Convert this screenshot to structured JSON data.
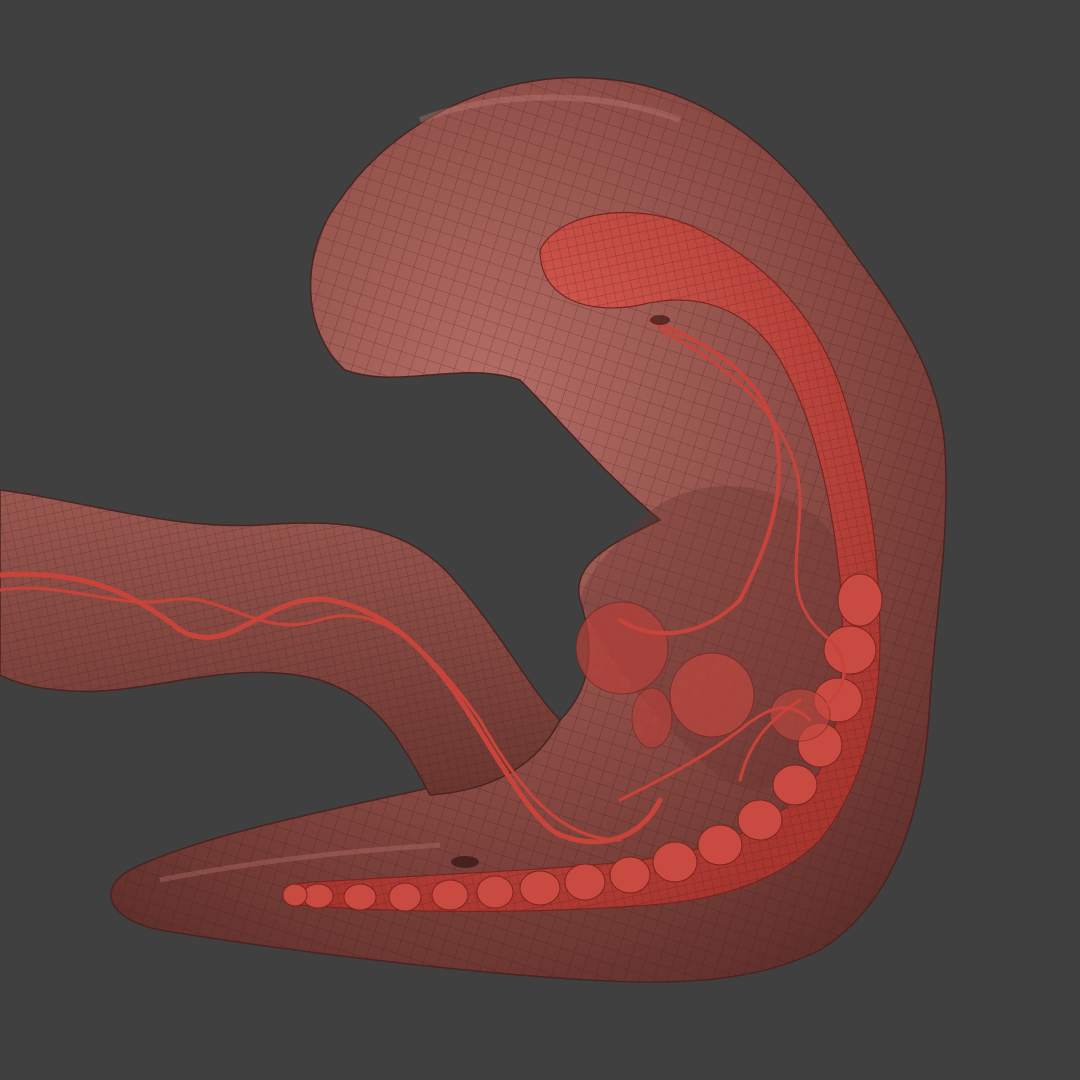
{
  "scene": {
    "background_color": "#404040",
    "colors": {
      "body": "#8a4a44",
      "body_light": "#a8625a",
      "body_dark": "#5e2e2a",
      "wire": "#3a1a18",
      "organ": "#c0453c",
      "organ_light": "#d9584c",
      "vessel": "#c8443a"
    }
  }
}
